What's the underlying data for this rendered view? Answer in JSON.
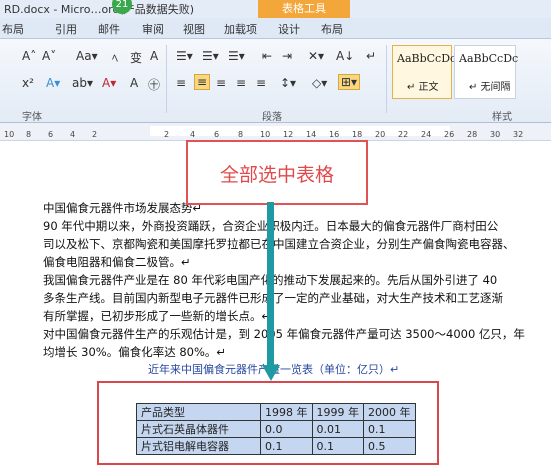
{
  "window": {
    "title": "RD.docx - Micro…ord(产品数据失败)",
    "badge": "21",
    "context_tab_group": "表格工具"
  },
  "tabs": [
    {
      "label": "布局"
    },
    {
      "label": "引用"
    },
    {
      "label": "邮件"
    },
    {
      "label": "审阅"
    },
    {
      "label": "视图"
    },
    {
      "label": "加载项"
    },
    {
      "label": "设计"
    },
    {
      "label": "布局"
    }
  ],
  "ribbon": {
    "font_group_label": "字体",
    "paragraph_group_label": "段落",
    "styles_group_label": "样式",
    "font_row1": [
      "A˄",
      "A˅",
      "Aa▾",
      "ﾍ",
      "变",
      "A"
    ],
    "font_row2": [
      "x²",
      "A▾",
      "ab▾",
      "A▾",
      "A",
      "㊉"
    ],
    "para_row1": [
      "☰▾",
      "☰▾",
      "☰▾",
      "⇤",
      "⇥",
      "✕▾",
      "A↓",
      "↵"
    ],
    "para_row2": [
      "≡",
      "≡",
      "≡",
      "≡",
      "≡",
      "↕▾",
      "◇▾",
      "⊞▾"
    ],
    "styles": [
      {
        "sample": "AaBbCcDc",
        "name": "↵ 正文",
        "selected": true
      },
      {
        "sample": "AaBbCcDc",
        "name": "↵ 无间隔",
        "selected": false
      }
    ]
  },
  "ruler": {
    "numbers": [
      "10",
      "8",
      "6",
      "4",
      "2",
      "",
      "2",
      "4",
      "6",
      "8",
      "10",
      "12",
      "14",
      "16",
      "18",
      "20",
      "22",
      "24",
      "26",
      "28",
      "30",
      "32"
    ]
  },
  "document": {
    "lines": [
      "中国偏食元器件市场发展态势↵",
      "90 年代中期以来，外商投资踊跃，合资企业积极内迁。日本最大的偏食元器件厂商村田公",
      "司以及松下、京都陶瓷和美国摩托罗拉都已在中国建立合资企业，分别生产偏食陶瓷电容器、",
      "偏食电阻器和偏食二极管。↵",
      "我国偏食元器件产业是在 80 年代彩电国产化的推动下发展起来的。先后从国外引进了 40",
      "多条生产线。目前国内新型电子元器件已形成了一定的产业基础，对大生产技术和工艺逐渐",
      "有所掌握，已初步形成了一些新的增长点。↵",
      "对中国偏食元器件生产的乐观估计是，到 2005 年偏食元器件产量可达 3500～4000 亿只，年",
      "均增长 30%。偏食化率达 80%。↵"
    ],
    "table_title": "近年来中国偏食元器件产量一览表（单位：亿只）↵",
    "table": {
      "headers": [
        "产品类型",
        "1998 年",
        "1999 年",
        "2000 年"
      ],
      "rows": [
        [
          "片式石英晶体器件",
          "0.0",
          "0.01",
          "0.1"
        ],
        [
          "片式铝电解电容器",
          "0.1",
          "0.1",
          "0.5"
        ]
      ]
    }
  },
  "annotation": {
    "text": "全部选中表格",
    "color": "#e14a4a",
    "arrow_color": "#1f9aa2"
  }
}
